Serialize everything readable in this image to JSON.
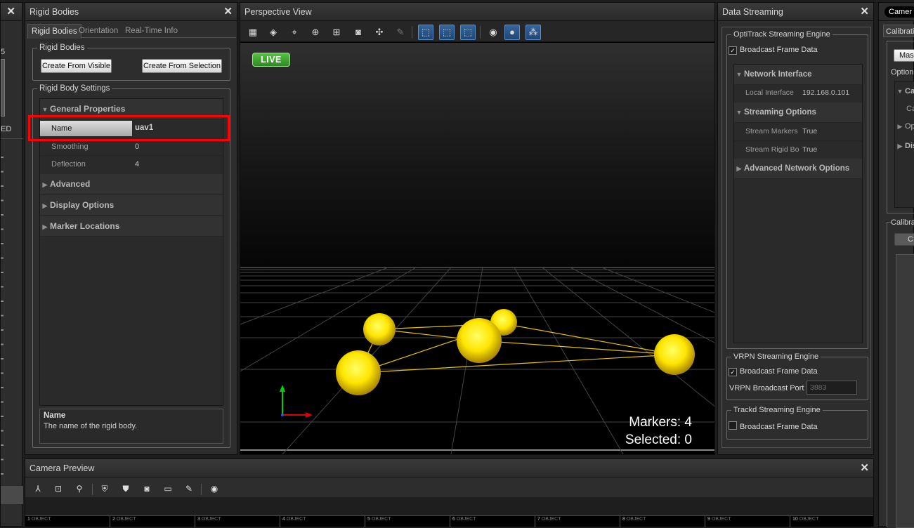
{
  "far_left": {
    "values": [
      "5",
      "ED"
    ]
  },
  "rigid_bodies": {
    "title": "Rigid Bodies",
    "tabs": [
      "Rigid Bodies",
      "Orientation",
      "Real-Time Info"
    ],
    "group1_title": "Rigid Bodies",
    "btn_create_visible": "Create From Visible",
    "btn_create_selection": "Create From Selection",
    "group2_title": "Rigid Body Settings",
    "general_header": "General Properties",
    "props": [
      {
        "label": "Name",
        "value": "uav1"
      },
      {
        "label": "Smoothing",
        "value": "0"
      },
      {
        "label": "Deflection",
        "value": "4"
      }
    ],
    "sections": [
      "Advanced",
      "Display Options",
      "Marker Locations"
    ],
    "help_title": "Name",
    "help_text": "The name of the rigid body."
  },
  "perspective": {
    "title": "Perspective View",
    "live_label": "LIVE",
    "markers_label": "Markers: 4",
    "selected_label": "Selected: 0"
  },
  "data_streaming": {
    "title": "Data Streaming",
    "optitrack_title": "OptiTrack Streaming Engine",
    "broadcast_label": "Broadcast Frame Data",
    "network_header": "Network Interface",
    "local_interface_label": "Local Interface",
    "local_interface_value": "192.168.0.101",
    "streaming_header": "Streaming Options",
    "stream_markers_label": "Stream Markers",
    "stream_markers_value": "True",
    "stream_rigid_label": "Stream Rigid Bo",
    "stream_rigid_value": "True",
    "advanced_header": "Advanced Network Options",
    "vrpn_title": "VRPN Streaming Engine",
    "vrpn_port_label": "VRPN Broadcast Port",
    "vrpn_port_value": "3883",
    "trackd_title": "Trackd Streaming Engine"
  },
  "calibration": {
    "tab_camera": "Camer",
    "tab_calibration": "Calibrati",
    "mask_btn": "Mas",
    "options_label": "Option",
    "tree_items": [
      "Ca",
      "Ca",
      "Op",
      "Dis"
    ],
    "calibrate_label": "Calibra",
    "c_btn": "C"
  },
  "camera_preview": {
    "title": "Camera Preview",
    "cams": [
      {
        "num": "1",
        "label": "OBJECT"
      },
      {
        "num": "2",
        "label": "OBJECT"
      },
      {
        "num": "3",
        "label": "OBJECT"
      },
      {
        "num": "4",
        "label": "OBJECT"
      },
      {
        "num": "5",
        "label": "OBJECT"
      },
      {
        "num": "6",
        "label": "OBJECT"
      },
      {
        "num": "7",
        "label": "OBJECT"
      },
      {
        "num": "8",
        "label": "OBJECT"
      },
      {
        "num": "9",
        "label": "OBJECT"
      },
      {
        "num": "10",
        "label": "OBJECT"
      }
    ]
  },
  "colors": {
    "highlight": "#ff0000",
    "live": "#3c9a2e",
    "marker": "#ffe400",
    "selected_tool": "#2a5a8e"
  }
}
